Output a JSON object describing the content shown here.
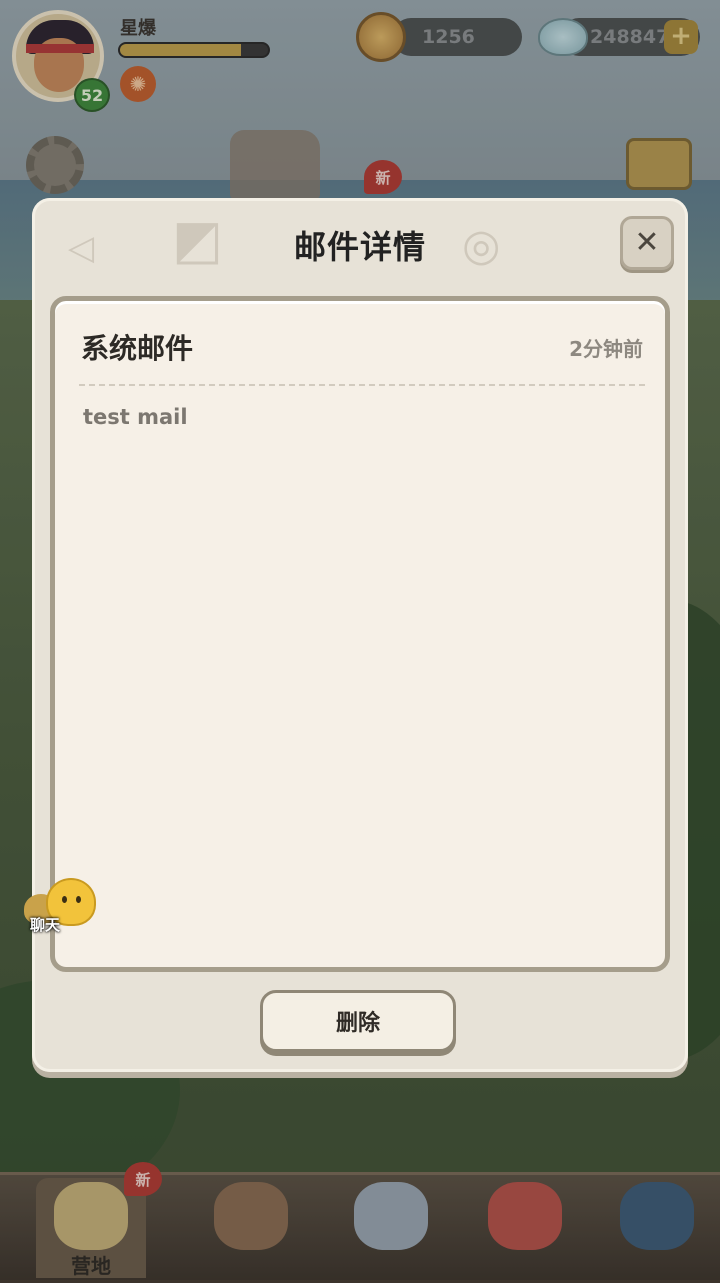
{
  "hud": {
    "player_name": "星爆",
    "level": "52",
    "xp_progress_percent": 82,
    "gold": "1256",
    "gems": "248847",
    "plus_label": "+"
  },
  "badges": {
    "new": "新"
  },
  "dialog": {
    "title": "邮件详情",
    "close_label": "✕",
    "mail": {
      "sender": "系统邮件",
      "time": "2分钟前",
      "body": "test mail"
    },
    "delete_label": "删除"
  },
  "chat": {
    "label": "聊天"
  },
  "bottom_nav": {
    "items": [
      {
        "label": "营地",
        "color": "#c7b37a"
      },
      {
        "label": "",
        "color": "#8a6c52"
      },
      {
        "label": "",
        "color": "#9aa7b3"
      },
      {
        "label": "",
        "color": "#b5524a"
      },
      {
        "label": "",
        "color": "#3e5c78"
      }
    ]
  }
}
